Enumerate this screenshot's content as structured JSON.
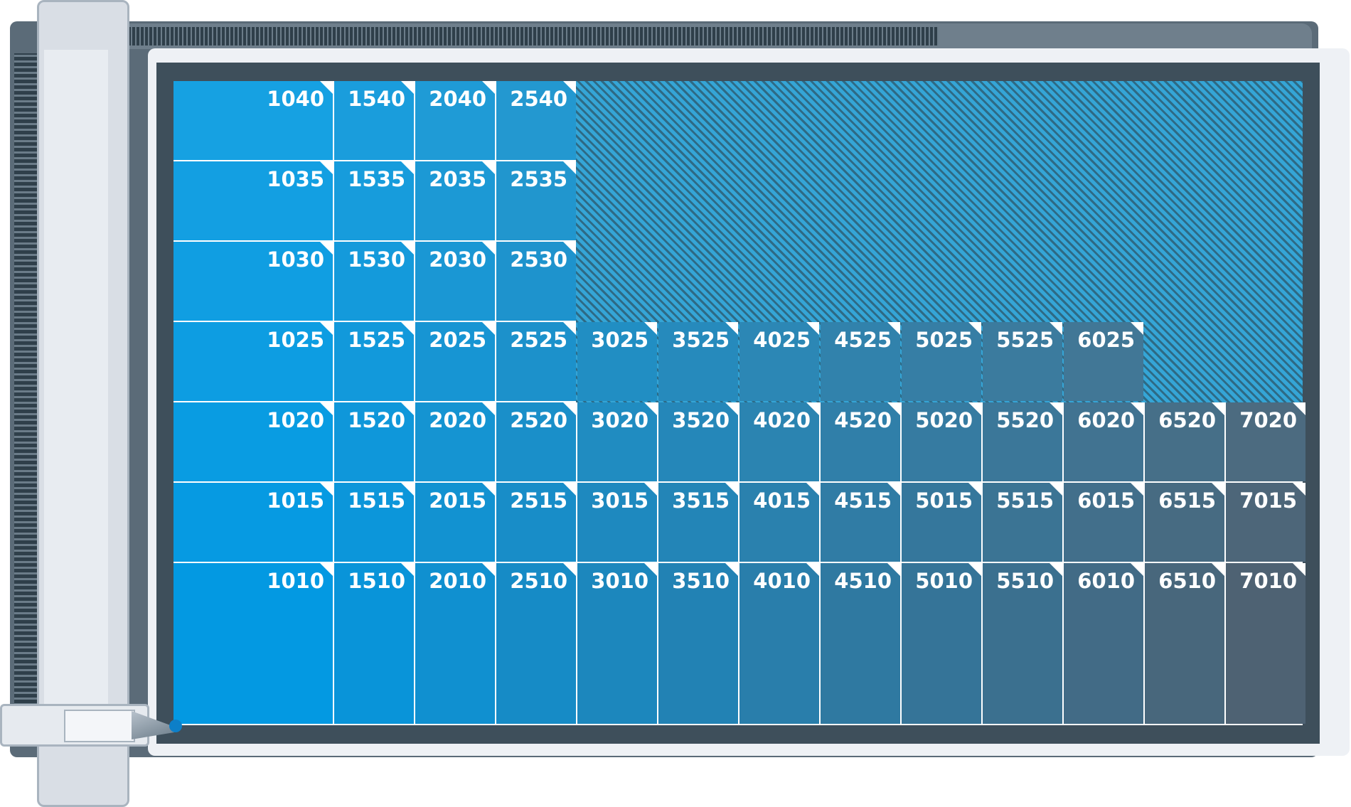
{
  "colors": {
    "rail_dark": "#3e4f5b",
    "frame_light": "#eef1f5",
    "hatch_dark": "#2e6a85",
    "hatch_light": "#35a5d6",
    "start_blue": "#0399e2",
    "end_slate": "#4e6273"
  },
  "icons": [
    "cutter-tool-icon",
    "corner-fold-icon"
  ],
  "grid": {
    "rows": [
      {
        "cells": [
          "1040",
          "1540",
          "2040",
          "2540"
        ]
      },
      {
        "cells": [
          "1035",
          "1535",
          "2035",
          "2535"
        ]
      },
      {
        "cells": [
          "1030",
          "1530",
          "2030",
          "2530"
        ]
      },
      {
        "cells": [
          "1025",
          "1525",
          "2025",
          "2525",
          "3025",
          "3525",
          "4025",
          "4525",
          "5025",
          "5525",
          "6025"
        ]
      },
      {
        "cells": [
          "1020",
          "1520",
          "2020",
          "2520",
          "3020",
          "3520",
          "4020",
          "4520",
          "5020",
          "5520",
          "6020",
          "6520",
          "7020"
        ]
      },
      {
        "cells": [
          "1015",
          "1515",
          "2015",
          "2515",
          "3015",
          "3515",
          "4015",
          "4515",
          "5015",
          "5515",
          "6015",
          "6515",
          "7015"
        ]
      },
      {
        "cells": [
          "1010",
          "1510",
          "2010",
          "2510",
          "3010",
          "3510",
          "4010",
          "4510",
          "5010",
          "5510",
          "6010",
          "6510",
          "7010"
        ]
      }
    ]
  }
}
